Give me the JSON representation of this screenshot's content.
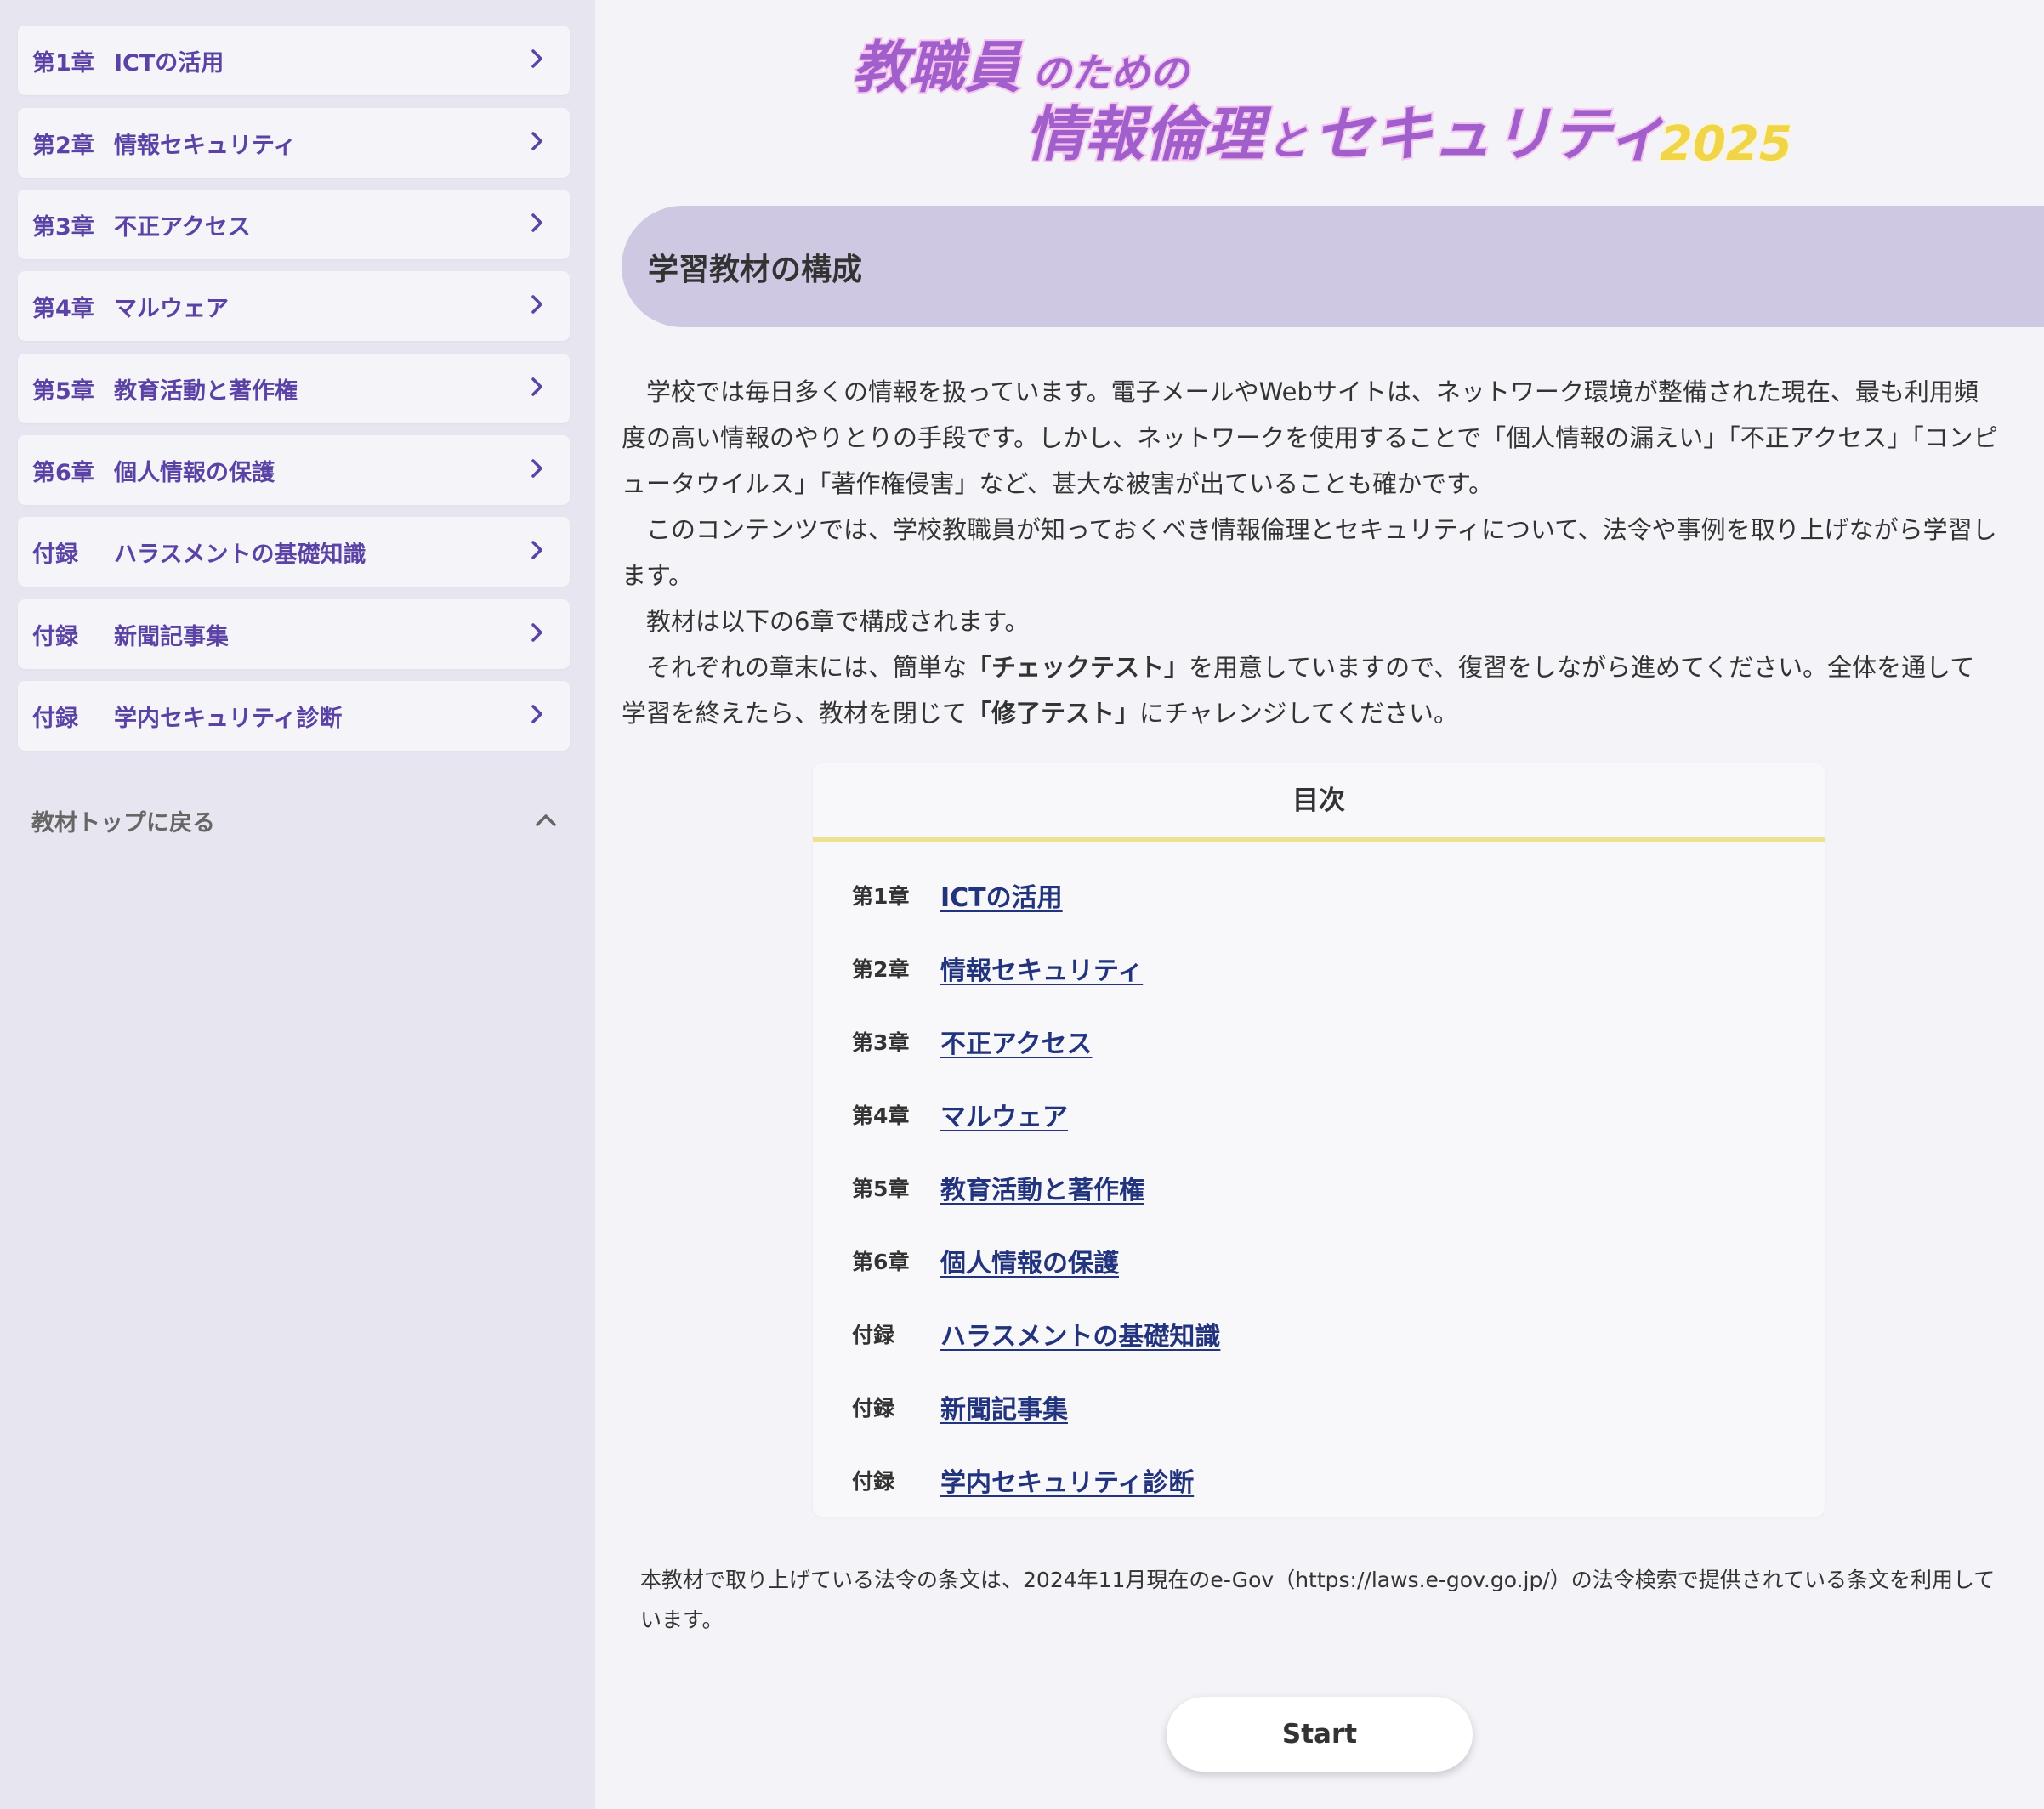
{
  "colors": {
    "accent_purple": "#5b43a6",
    "header_band": "#cfc8e2",
    "logo_purple": "#a15fcb",
    "logo_pink": "#f6c4f0",
    "logo_year": "#f0d44a",
    "link": "#23347f",
    "toc_rule": "#ece290",
    "sidebar_bg": "#e7e5f0"
  },
  "logo": {
    "line1_kanji": "教職員",
    "line1_kana": "のための",
    "line2_a": "情報倫理",
    "line2_b": "と",
    "line2_c": "セキュリティ",
    "year": "2025"
  },
  "sidebar": {
    "items": [
      {
        "prefix": "第1章",
        "label": "ICTの活用",
        "icon": "chevron-right-icon"
      },
      {
        "prefix": "第2章",
        "label": "情報セキュリティ",
        "icon": "chevron-right-icon"
      },
      {
        "prefix": "第3章",
        "label": "不正アクセス",
        "icon": "chevron-right-icon"
      },
      {
        "prefix": "第4章",
        "label": "マルウェア",
        "icon": "chevron-right-icon"
      },
      {
        "prefix": "第5章",
        "label": "教育活動と著作権",
        "icon": "chevron-right-icon"
      },
      {
        "prefix": "第6章",
        "label": "個人情報の保護",
        "icon": "chevron-right-icon"
      },
      {
        "prefix": "付録",
        "label": "ハラスメントの基礎知識",
        "icon": "chevron-right-icon"
      },
      {
        "prefix": "付録",
        "label": "新聞記事集",
        "icon": "chevron-right-icon"
      },
      {
        "prefix": "付録",
        "label": "学内セキュリティ診断",
        "icon": "chevron-right-icon"
      }
    ],
    "back_to_top": {
      "label": "教材トップに戻る",
      "icon": "chevron-up-icon"
    }
  },
  "main": {
    "section_title": "学習教材の構成",
    "intro": {
      "p1": "学校では毎日多くの情報を扱っています。電子メールやWebサイトは、ネットワーク環境が整備された現在、最も利用頻度の高い情報のやりとりの手段です。しかし、ネットワークを使用することで「個人情報の漏えい」「不正アクセス」「コンピュータウイルス」「著作権侵害」など、甚大な被害が出ていることも確かです。",
      "p2": "このコンテンツでは、学校教職員が知っておくべき情報倫理とセキュリティについて、法令や事例を取り上げながら学習します。",
      "p3": "教材は以下の6章で構成されます。",
      "p4_a": "それぞれの章末には、簡単な",
      "p4_b": "「チェックテスト」",
      "p4_c": "を用意していますので、復習をしながら進めてください。全体を通して学習を終えたら、教材を閉じて",
      "p4_d": "「修了テスト」",
      "p4_e": "にチャレンジしてください。"
    },
    "toc": {
      "title": "目次",
      "items": [
        {
          "prefix": "第1章",
          "label": "ICTの活用"
        },
        {
          "prefix": "第2章",
          "label": "情報セキュリティ"
        },
        {
          "prefix": "第3章",
          "label": "不正アクセス"
        },
        {
          "prefix": "第4章",
          "label": "マルウェア"
        },
        {
          "prefix": "第5章",
          "label": "教育活動と著作権"
        },
        {
          "prefix": "第6章",
          "label": "個人情報の保護"
        },
        {
          "prefix": "付録",
          "label": "ハラスメントの基礎知識"
        },
        {
          "prefix": "付録",
          "label": "新聞記事集"
        },
        {
          "prefix": "付録",
          "label": "学内セキュリティ診断"
        }
      ]
    },
    "footnote": "本教材で取り上げている法令の条文は、2024年11月現在のe-Gov（https://laws.e-gov.go.jp/）の法令検索で提供されている条文を利用しています。",
    "start_label": "Start"
  }
}
